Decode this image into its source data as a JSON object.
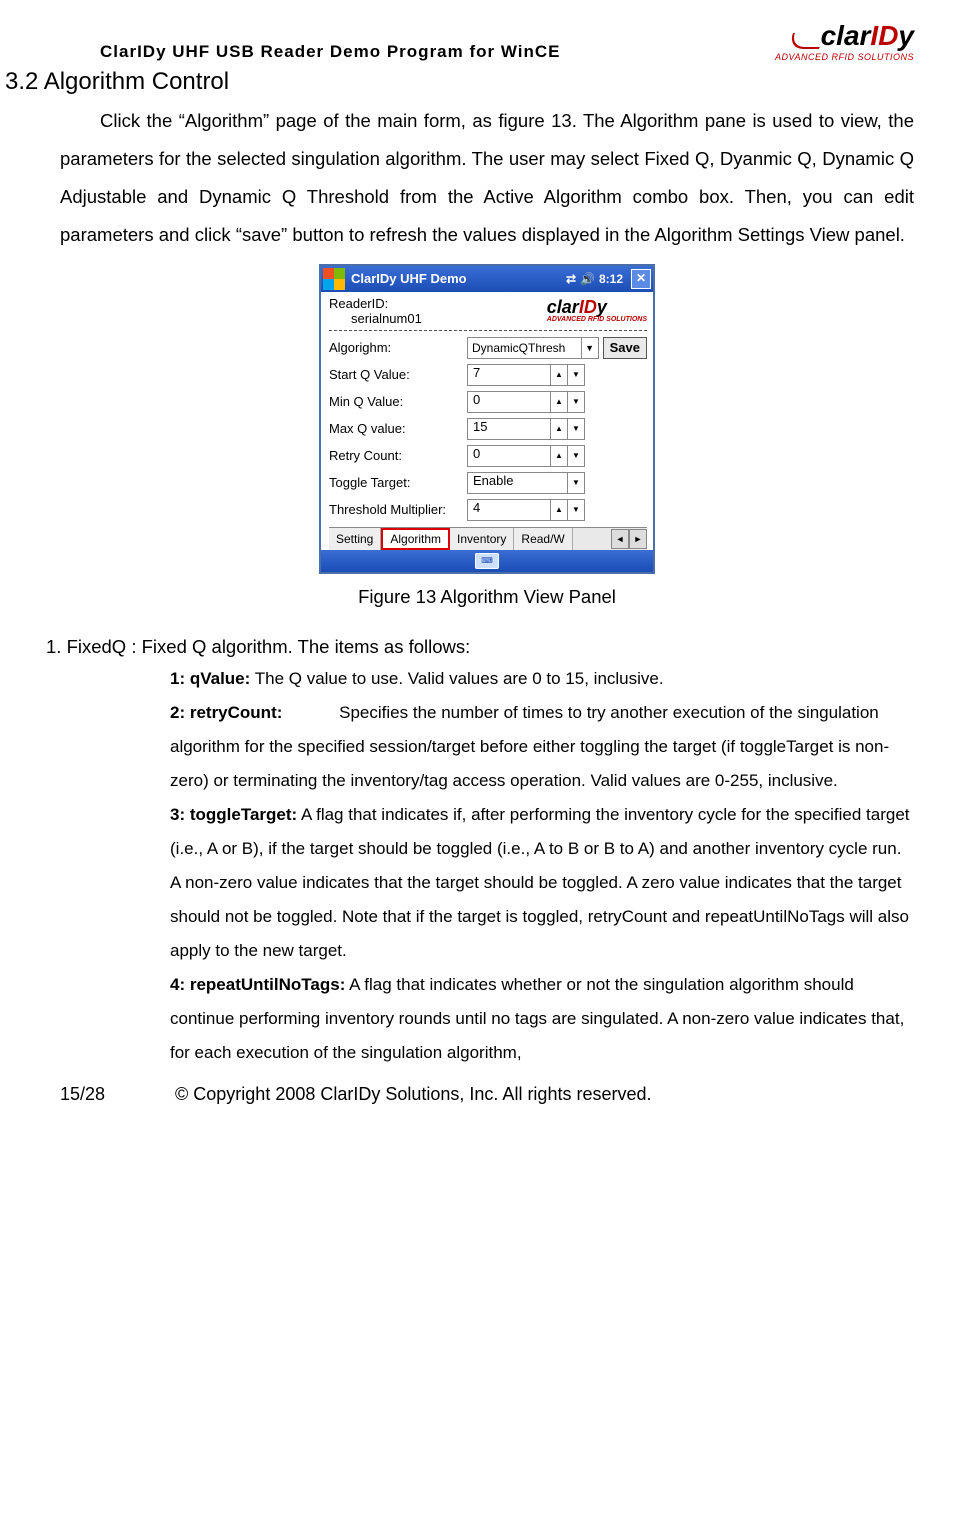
{
  "header": {
    "doc_title": "ClarIDy UHF USB Reader Demo Program for WinCE",
    "logo_text_clar": "clar",
    "logo_text_id": "ID",
    "logo_text_y": "y",
    "logo_sub": "ADVANCED RFID SOLUTIONS"
  },
  "section_heading": "3.2 Algorithm Control",
  "para1": "Click the “Algorithm” page of the main form, as figure 13. The Algorithm pane is used to view, the parameters for the selected singulation algorithm. The user may select Fixed Q, Dyanmic Q, Dynamic Q Adjustable and Dynamic Q Threshold from the Active Algorithm combo box.   Then, you can edit parameters and click “save” button to refresh the values displayed in the Algorithm Settings View panel.",
  "figure_caption": "Figure 13 Algorithm View Panel",
  "list1_lead": "1.   FixedQ : Fixed Q algorithm. The items as follows:",
  "sub": {
    "l1": "1: qValue:",
    "t1": " The Q value to use. Valid values are 0 to 15, inclusive.",
    "l2": "2: retryCount:",
    "t2": " Specifies the number of times to try another execution of the singulation algorithm for the specified session/target before either   toggling the target (if toggleTarget is non-zero) or terminating the inventory/tag access operation.   Valid values are 0-255, inclusive.",
    "l3": "3: toggleTarget:",
    "t3": " A flag that indicates if, after performing the inventory cycle for the specified target (i.e., A or B), if the target should be toggled (i.e., A to B or B to A) and another inventory cycle run.   A non-zero value indicates that the target should be toggled.   A zero value indicates that the target should not be toggled.   Note that if the target is toggled, retryCount and repeatUntilNoTags will also apply to the new target.",
    "l4": "4: repeatUntilNoTags:",
    "t4": " A flag that indicates whether or not the singulation algorithm should continue performing inventory rounds until no tags are singulated. A non-zero value indicates that, for each execution of the singulation algorithm,"
  },
  "footer": {
    "page": "15/28",
    "copyright": "© Copyright 2008 ClarIDy Solutions, Inc. All rights reserved."
  },
  "win": {
    "title": "ClarIDy UHF Demo",
    "clock": "8:12",
    "readerid_lbl": "ReaderID:",
    "readerid_val": "serialnum01",
    "algo_lbl": "Algorighm:",
    "algo_val": "DynamicQThresh",
    "save": "Save",
    "rows": [
      {
        "lbl": "Start Q Value:",
        "val": "7",
        "type": "spin"
      },
      {
        "lbl": "Min Q Value:",
        "val": "0",
        "type": "spin"
      },
      {
        "lbl": "Max Q value:",
        "val": "15",
        "type": "spin"
      },
      {
        "lbl": "Retry Count:",
        "val": "0",
        "type": "spin"
      },
      {
        "lbl": "Toggle Target:",
        "val": "Enable",
        "type": "combo"
      },
      {
        "lbl": "Threshold Multiplier:",
        "val": "4",
        "type": "spin"
      }
    ],
    "tabs": [
      "Setting",
      "Algorithm",
      "Inventory",
      "Read/W"
    ]
  }
}
